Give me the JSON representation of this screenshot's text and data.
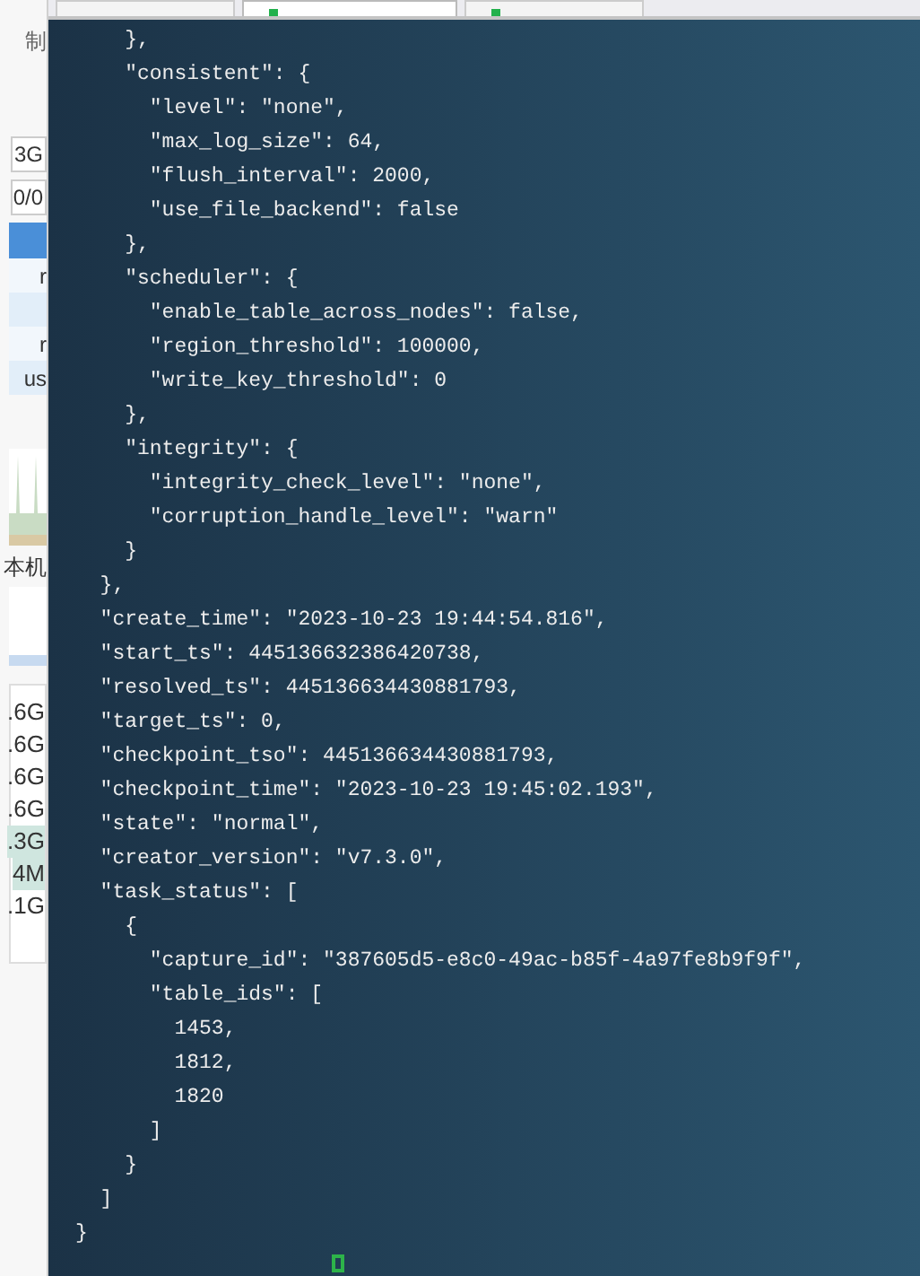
{
  "tabs": [
    {
      "selected": false
    },
    {
      "selected": true
    },
    {
      "selected": false
    }
  ],
  "side_panel": {
    "top_label": "制",
    "fields": [
      "3G",
      "0/0"
    ],
    "list_items": [
      {
        "text": "r",
        "selected": false
      },
      {
        "selected": false
      },
      {
        "text": "r",
        "selected": false
      },
      {
        "text": "us",
        "selected": false
      }
    ],
    "host_label": "本机",
    "sizes": [
      {
        "text": ".6G",
        "selected": false
      },
      {
        "text": ".6G",
        "selected": false
      },
      {
        "text": ".6G",
        "selected": false
      },
      {
        "text": ".6G",
        "selected": false
      },
      {
        "text": ".3G",
        "selected": true
      },
      {
        "text": "4M",
        "selected": true
      },
      {
        "text": ".1G",
        "selected": false
      }
    ]
  },
  "terminal": {
    "lines": [
      "    },",
      "    \"consistent\": {",
      "      \"level\": \"none\",",
      "      \"max_log_size\": 64,",
      "      \"flush_interval\": 2000,",
      "      \"use_file_backend\": false",
      "    },",
      "    \"scheduler\": {",
      "      \"enable_table_across_nodes\": false,",
      "      \"region_threshold\": 100000,",
      "      \"write_key_threshold\": 0",
      "    },",
      "    \"integrity\": {",
      "      \"integrity_check_level\": \"none\",",
      "      \"corruption_handle_level\": \"warn\"",
      "    }",
      "  },",
      "  \"create_time\": \"2023-10-23 19:44:54.816\",",
      "  \"start_ts\": 445136632386420738,",
      "  \"resolved_ts\": 445136634430881793,",
      "  \"target_ts\": 0,",
      "  \"checkpoint_tso\": 445136634430881793,",
      "  \"checkpoint_time\": \"2023-10-23 19:45:02.193\",",
      "  \"state\": \"normal\",",
      "  \"creator_version\": \"v7.3.0\",",
      "  \"task_status\": [",
      "    {",
      "      \"capture_id\": \"387605d5-e8c0-49ac-b85f-4a97fe8b9f9f\",",
      "      \"table_ids\": [",
      "        1453,",
      "        1812,",
      "        1820",
      "      ]",
      "    }",
      "  ]",
      "}"
    ]
  }
}
